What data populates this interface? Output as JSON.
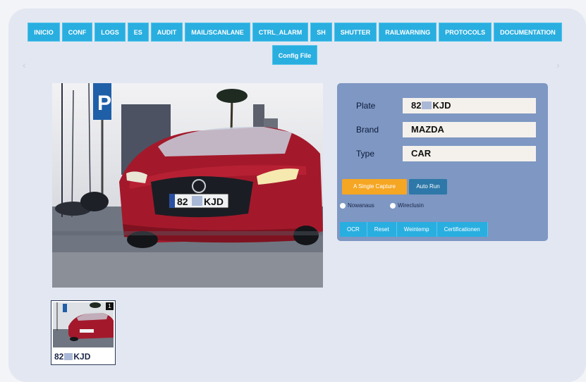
{
  "nav": {
    "items": [
      "Inicio",
      "Conf",
      "Logs",
      "ES",
      "Audit",
      "Mail/ScanLane",
      "CTRL_ALARM",
      "Sh",
      "Shutter",
      "Railwarning",
      "Protocols",
      "Documentation"
    ],
    "config_label": "Config File",
    "prev_arrow": "‹",
    "next_arrow": "›"
  },
  "result": {
    "plate_label": "Plate",
    "plate_prefix": "82",
    "plate_suffix": "KJD",
    "brand_label": "Brand",
    "brand_value": "MAZDA",
    "type_label": "Type",
    "type_value": "CAR"
  },
  "actions": {
    "primary_label": "A Single Capture",
    "secondary_label": "Auto Run",
    "check1_label": "Nowanaus",
    "check2_label": "Wireclusin",
    "bottom": [
      "OCR",
      "Reset",
      "Weintemp",
      "Certificationen"
    ]
  },
  "thumbnail": {
    "badge": "1",
    "plate_prefix": "82",
    "plate_suffix": "KJD"
  },
  "photo": {
    "sign_text": "P",
    "license_prefix": "82",
    "license_suffix": "KJD"
  },
  "colors": {
    "nav_button": "#29aee0",
    "panel": "#7e97c3",
    "primary_action": "#f5a623",
    "secondary_action": "#2d78a8"
  }
}
